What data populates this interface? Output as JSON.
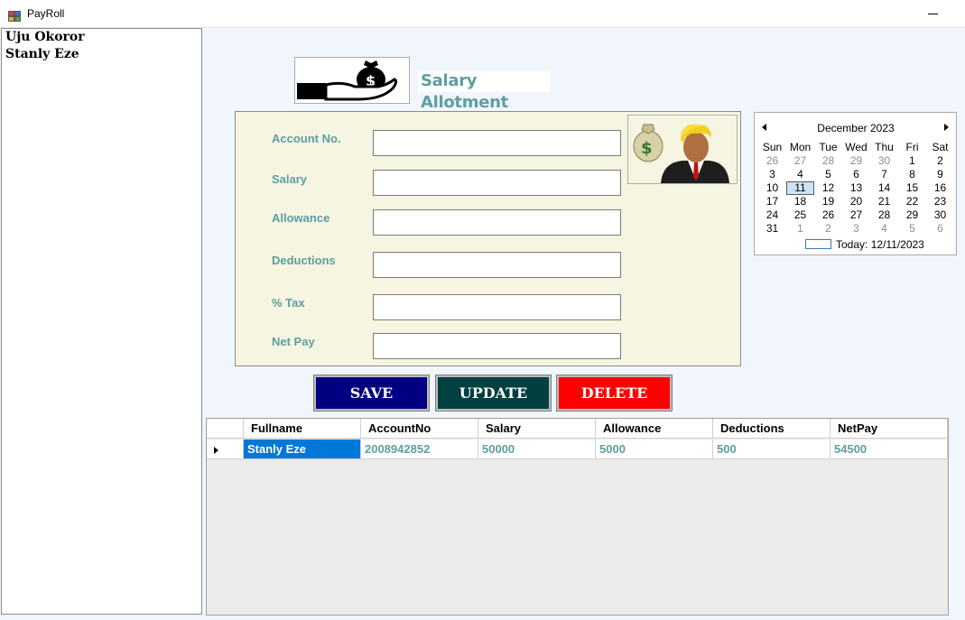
{
  "window": {
    "title": "PayRoll"
  },
  "employees": [
    "Uju Okoror",
    "Stanly Eze"
  ],
  "heading": "Salary Allotment",
  "form": {
    "fields": [
      {
        "label": "Account No.",
        "value": ""
      },
      {
        "label": "Salary",
        "value": ""
      },
      {
        "label": "Allowance",
        "value": ""
      },
      {
        "label": "Deductions",
        "value": ""
      },
      {
        "label": "% Tax",
        "value": ""
      },
      {
        "label": "Net Pay",
        "value": ""
      }
    ]
  },
  "calendar": {
    "month_label": "December 2023",
    "days": [
      "Sun",
      "Mon",
      "Tue",
      "Wed",
      "Thu",
      "Fri",
      "Sat"
    ],
    "weeks": [
      [
        "26",
        "27",
        "28",
        "29",
        "30",
        "1",
        "2"
      ],
      [
        "3",
        "4",
        "5",
        "6",
        "7",
        "8",
        "9"
      ],
      [
        "10",
        "11",
        "12",
        "13",
        "14",
        "15",
        "16"
      ],
      [
        "17",
        "18",
        "19",
        "20",
        "21",
        "22",
        "23"
      ],
      [
        "24",
        "25",
        "26",
        "27",
        "28",
        "29",
        "30"
      ],
      [
        "31",
        "1",
        "2",
        "3",
        "4",
        "5",
        "6"
      ]
    ],
    "selected": "11",
    "today_label": "Today: 12/11/2023"
  },
  "buttons": {
    "save": {
      "label": "SAVE",
      "color": "#000080"
    },
    "update": {
      "label": "UPDATE",
      "color": "#004040"
    },
    "delete": {
      "label": "DELETE",
      "color": "#ff0000"
    }
  },
  "grid": {
    "columns": [
      "Fullname",
      "AccountNo",
      "Salary",
      "Allowance",
      "Deductions",
      "NetPay"
    ],
    "rows": [
      [
        "Stanly Eze",
        "2008942852",
        "50000",
        "5000",
        "500",
        "54500"
      ]
    ]
  },
  "colors": {
    "accent": "#5f9ea0",
    "form_bg": "#f5f5e1",
    "selection": "#0078d7"
  }
}
